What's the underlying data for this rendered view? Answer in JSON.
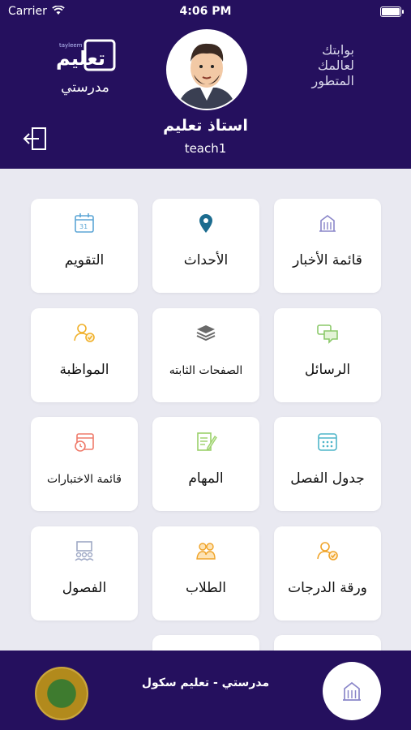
{
  "status_bar": {
    "carrier": "Carrier",
    "time": "4:06 PM"
  },
  "header": {
    "brand_sub": "مدرستي",
    "tagline": [
      "بوابتك",
      "لعالمك",
      "المتطور"
    ],
    "user_name": "استاذ تعليم",
    "user_login": "teach1"
  },
  "grid": [
    {
      "label": "قائمة الأخبار",
      "icon": "news-building-icon",
      "color": "#8a86c9"
    },
    {
      "label": "الأحداث",
      "icon": "location-pin-icon",
      "color": "#1c6c8f"
    },
    {
      "label": "التقويم",
      "icon": "calendar-icon",
      "color": "#5da6d6"
    },
    {
      "label": "الرسائل",
      "icon": "chat-bubbles-icon",
      "color": "#8cc96a"
    },
    {
      "label": "الصفحات الثابته",
      "icon": "layers-icon",
      "color": "#6a6a6a"
    },
    {
      "label": "المواظبة",
      "icon": "attendance-icon",
      "color": "#f0b02a"
    },
    {
      "label": "جدول الفصل",
      "icon": "schedule-icon",
      "color": "#4fb5c9"
    },
    {
      "label": "المهام",
      "icon": "tasks-icon",
      "color": "#9bd06a"
    },
    {
      "label": "قائمة الاختبارات",
      "icon": "exam-clock-icon",
      "color": "#ef7b6b"
    },
    {
      "label": "ورقة الدرجات",
      "icon": "grades-icon",
      "color": "#f0a42a"
    },
    {
      "label": "الطلاب",
      "icon": "students-icon",
      "color": "#f0a42a"
    },
    {
      "label": "الفصول",
      "icon": "classroom-icon",
      "color": "#9ea8c5"
    }
  ],
  "footer": {
    "school_name": "مدرستي - تعليم سكول"
  }
}
